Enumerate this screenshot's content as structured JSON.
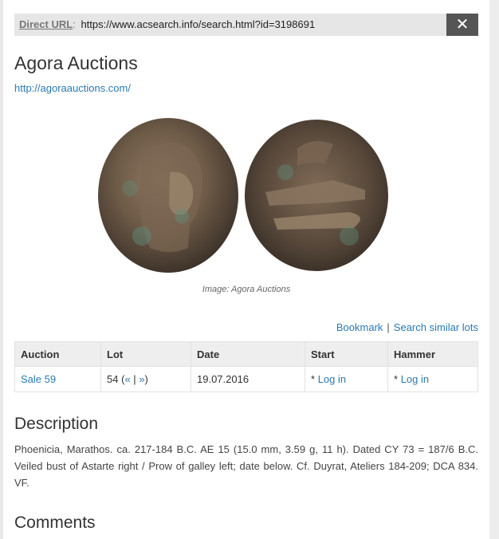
{
  "url_bar": {
    "label": "Direct URL",
    "url": "https://www.acsearch.info/search.html?id=3198691"
  },
  "close_glyph": "✕",
  "title": "Agora Auctions",
  "site_link": "http://agoraauctions.com/",
  "image_caption": "Image: Agora Auctions",
  "actions": {
    "bookmark": "Bookmark",
    "separator": "|",
    "similar": "Search similar lots"
  },
  "table": {
    "headers": [
      "Auction",
      "Lot",
      "Date",
      "Start",
      "Hammer"
    ],
    "row": {
      "auction": "Sale 59",
      "lot_number": "54",
      "lot_open": "(",
      "lot_prev": "«",
      "lot_sep": "|",
      "lot_next": "»",
      "lot_close": ")",
      "date": "19.07.2016",
      "start_prefix": "*",
      "start_link": "Log in",
      "hammer_prefix": "*",
      "hammer_link": "Log in"
    }
  },
  "description": {
    "heading": "Description",
    "text": "Phoenicia, Marathos. ca. 217-184 B.C. AE 15 (15.0 mm, 3.59 g, 11 h). Dated CY 73 = 187/6 B.C. Veiled bust of Astarte right / Prow of galley left; date below. Cf. Duyrat, Ateliers 184-209; DCA 834. VF."
  },
  "comments_heading": "Comments",
  "colors": {
    "link": "#2a7ab0",
    "close_bg": "#555555",
    "header_bg": "#eeeeee"
  }
}
